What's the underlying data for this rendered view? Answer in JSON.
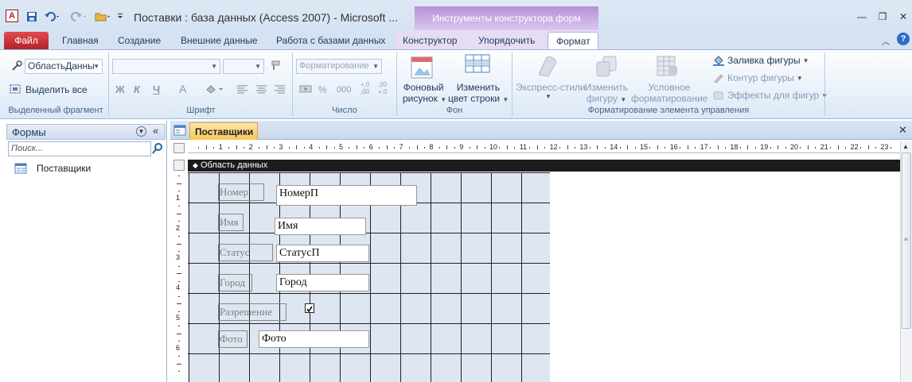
{
  "window": {
    "title": "Поставки : база данных (Access 2007)  -  Microsoft ...",
    "context_title": "Инструменты конструктора форм",
    "app_letter": "A"
  },
  "tabs": {
    "file": "Файл",
    "home": "Главная",
    "create": "Создание",
    "external": "Внешние данные",
    "db_tools": "Работа с базами данных",
    "design": "Конструктор",
    "arrange": "Упорядочить",
    "format": "Формат"
  },
  "ribbon": {
    "selection": {
      "object_combo": "ОбластьДанны",
      "select_all": "Выделить все",
      "group_label": "Выделенный фрагмент"
    },
    "font": {
      "font_combo": "",
      "size_combo": "",
      "bold": "Ж",
      "italic": "К",
      "underline": "Ч",
      "font_color": "А",
      "group_label": "Шрифт"
    },
    "number": {
      "format_combo": "Форматирование",
      "percent": "%",
      "thousands": "000",
      "inc_dec": "+,0 ,00",
      "dec_dec": ",00 +,0",
      "group_label": "Число"
    },
    "background": {
      "bg_image_1": "Фоновый",
      "bg_image_2": "рисунок",
      "alt_row_1": "Изменить",
      "alt_row_2": "цвет строки",
      "group_label": "Фон"
    },
    "control": {
      "quick_styles": "Экспресс-стили",
      "change_shape_1": "Изменить",
      "change_shape_2": "фигуру",
      "cond_1": "Условное",
      "cond_2": "форматирование",
      "fill": "Заливка фигуры",
      "outline": "Контур фигуры",
      "effects": "Эффекты для фигур",
      "group_label": "Форматирование элемента управления"
    }
  },
  "nav": {
    "header": "Формы",
    "search_placeholder": "Поиск...",
    "items": [
      "Поставщики"
    ]
  },
  "document": {
    "tab_label": "Поставщики",
    "section_label": "Область данных",
    "ruler_numbers": [
      "1",
      "2",
      "3",
      "4",
      "5",
      "6",
      "7",
      "8",
      "9",
      "10",
      "11",
      "12",
      "13",
      "14",
      "15",
      "16",
      "17",
      "18",
      "19",
      "20",
      "21",
      "22",
      "23"
    ],
    "vruler_numbers": [
      "1",
      "2",
      "3",
      "4",
      "5",
      "6"
    ]
  },
  "form": {
    "labels": [
      "Номер",
      "Имя",
      "Статус",
      "Город",
      "Разрешение",
      "Фото"
    ],
    "fields": [
      "НомерП",
      "Имя",
      "СтатусП",
      "Город",
      "Фото"
    ],
    "checkbox_checked": true
  },
  "colors": {
    "file_tab": "#c8343a",
    "context_tab": "#b591d6",
    "doc_tab": "#f8c65a",
    "grid_bg": "#dde6f1"
  }
}
